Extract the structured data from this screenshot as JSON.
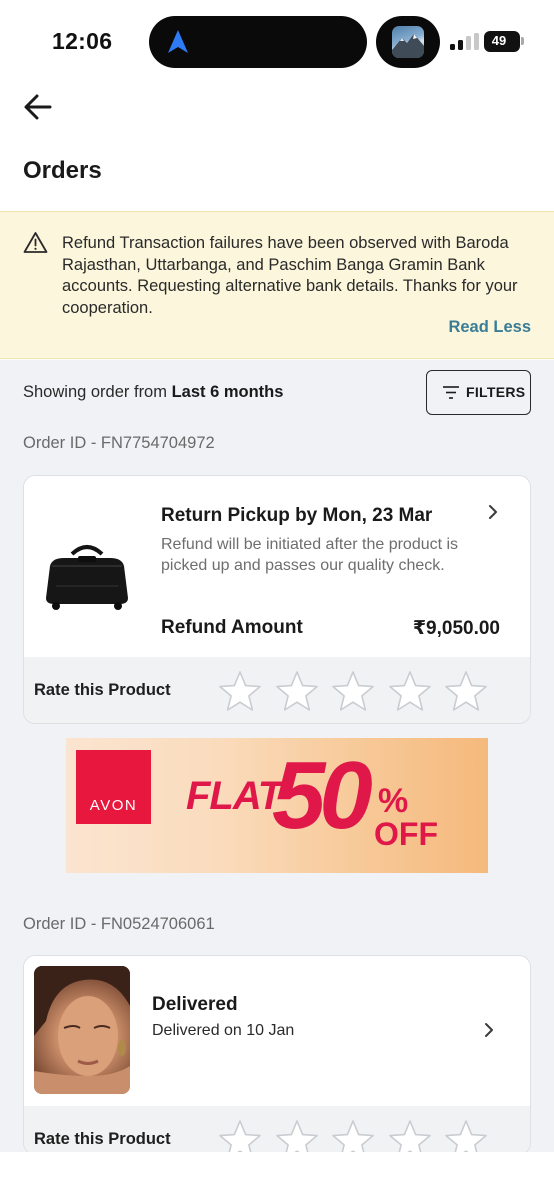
{
  "status_bar": {
    "time": "12:06",
    "battery": "49",
    "battery_level": 0.49,
    "signal_bars": 2
  },
  "header": {
    "back_icon": "arrow-left-icon",
    "title": "Orders"
  },
  "notice": {
    "icon": "warning-triangle-icon",
    "text": "Refund Transaction failures have been observed with Baroda Rajasthan, Uttarbanga, and Paschim Banga Gramin Bank accounts. Requesting alternative bank details. Thanks for your cooperation.",
    "action": "Read Less",
    "background": "#fbf6dc",
    "action_color": "#3a7c96"
  },
  "filter_bar": {
    "prefix": "Showing order from",
    "period": "Last 6 months",
    "button": "FILTERS"
  },
  "orders": [
    {
      "order_id": "Order ID - FN7754704972",
      "status_title": "Return Pickup by Mon, 23 Mar",
      "status_sub": "Refund will be initiated after the product is picked up and passes our quality check.",
      "refund_label": "Refund Amount",
      "refund_amount": "₹9,050.00",
      "rate_label": "Rate this Product",
      "rating": 0,
      "max_rating": 5
    },
    {
      "order_id": "Order ID - FN0524706061",
      "status_title": "Delivered",
      "status_sub": "Delivered on 10 Jan",
      "rate_label": "Rate this Product",
      "rating": 0,
      "max_rating": 5
    }
  ],
  "ad": {
    "brand": "AVON",
    "flat": "FLAT",
    "value": "50",
    "percent": "%",
    "off": "OFF",
    "color": "#e0184a"
  }
}
